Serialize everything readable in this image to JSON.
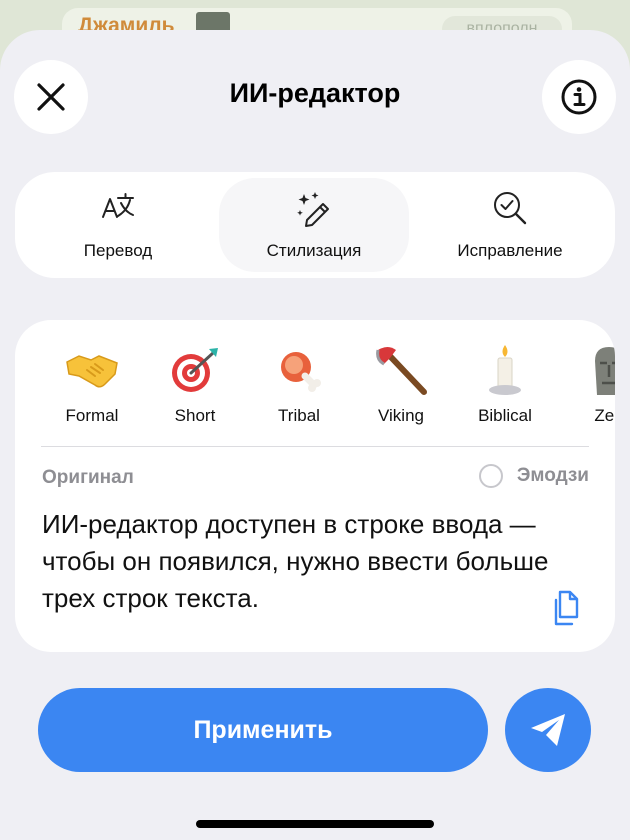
{
  "background": {
    "contact_name": "Джамиль",
    "pill_text": "вплополн"
  },
  "sheet": {
    "title": "ИИ-редактор"
  },
  "modes": [
    {
      "label": "Перевод",
      "icon": "translate-icon"
    },
    {
      "label": "Стилизация",
      "icon": "magic-pen-icon",
      "active": true
    },
    {
      "label": "Исправление",
      "icon": "search-check-icon"
    }
  ],
  "styles": [
    {
      "label": "Formal",
      "icon": "handshake-emoji"
    },
    {
      "label": "Short",
      "icon": "target-emoji"
    },
    {
      "label": "Tribal",
      "icon": "meat-bone-emoji"
    },
    {
      "label": "Viking",
      "icon": "axe-emoji"
    },
    {
      "label": "Biblical",
      "icon": "candle-emoji"
    },
    {
      "label": "Zen",
      "icon": "moai-emoji"
    }
  ],
  "original": {
    "label": "Оригинал",
    "emoji_toggle_label": "Эмодзи",
    "text": "ИИ-редактор доступен в строке ввода — чтобы он появился, нужно ввести больше трех строк текста."
  },
  "actions": {
    "apply_label": "Применить"
  },
  "colors": {
    "accent": "#3b86f2",
    "sheet_bg": "#efeff4",
    "secondary_text": "#8e8e93"
  }
}
